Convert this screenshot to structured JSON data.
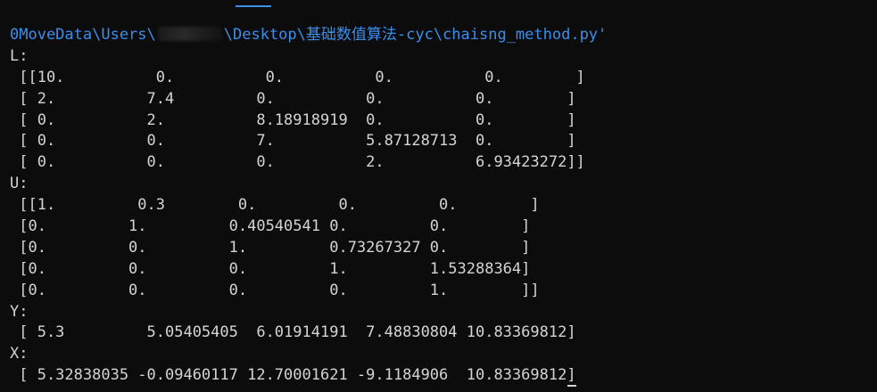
{
  "terminal": {
    "path_prefix": "0MoveData\\Users\\",
    "path_suffix": "\\Desktop\\基础数值算法-cyc\\chaisng_method.py'",
    "lines": [
      "L:",
      " [[10.          0.          0.          0.          0.        ]",
      " [ 2.          7.4         0.          0.          0.        ]",
      " [ 0.          2.          8.18918919  0.          0.        ]",
      " [ 0.          0.          7.          5.87128713  0.        ]",
      " [ 0.          0.          0.          2.          6.93423272]]",
      "U:",
      " [[1.         0.3        0.         0.         0.        ]",
      " [0.         1.         0.40540541 0.         0.        ]",
      " [0.         0.         1.         0.73267327 0.        ]",
      " [0.         0.         0.         1.         1.53288364]",
      " [0.         0.         0.         0.         1.        ]]",
      "Y:",
      " [ 5.3         5.05405405  6.01914191  7.48830804 10.83369812]",
      "X:",
      " [ 5.32838035 -0.09460117 12.70001621 -9.1184906  10.83369812]"
    ]
  }
}
